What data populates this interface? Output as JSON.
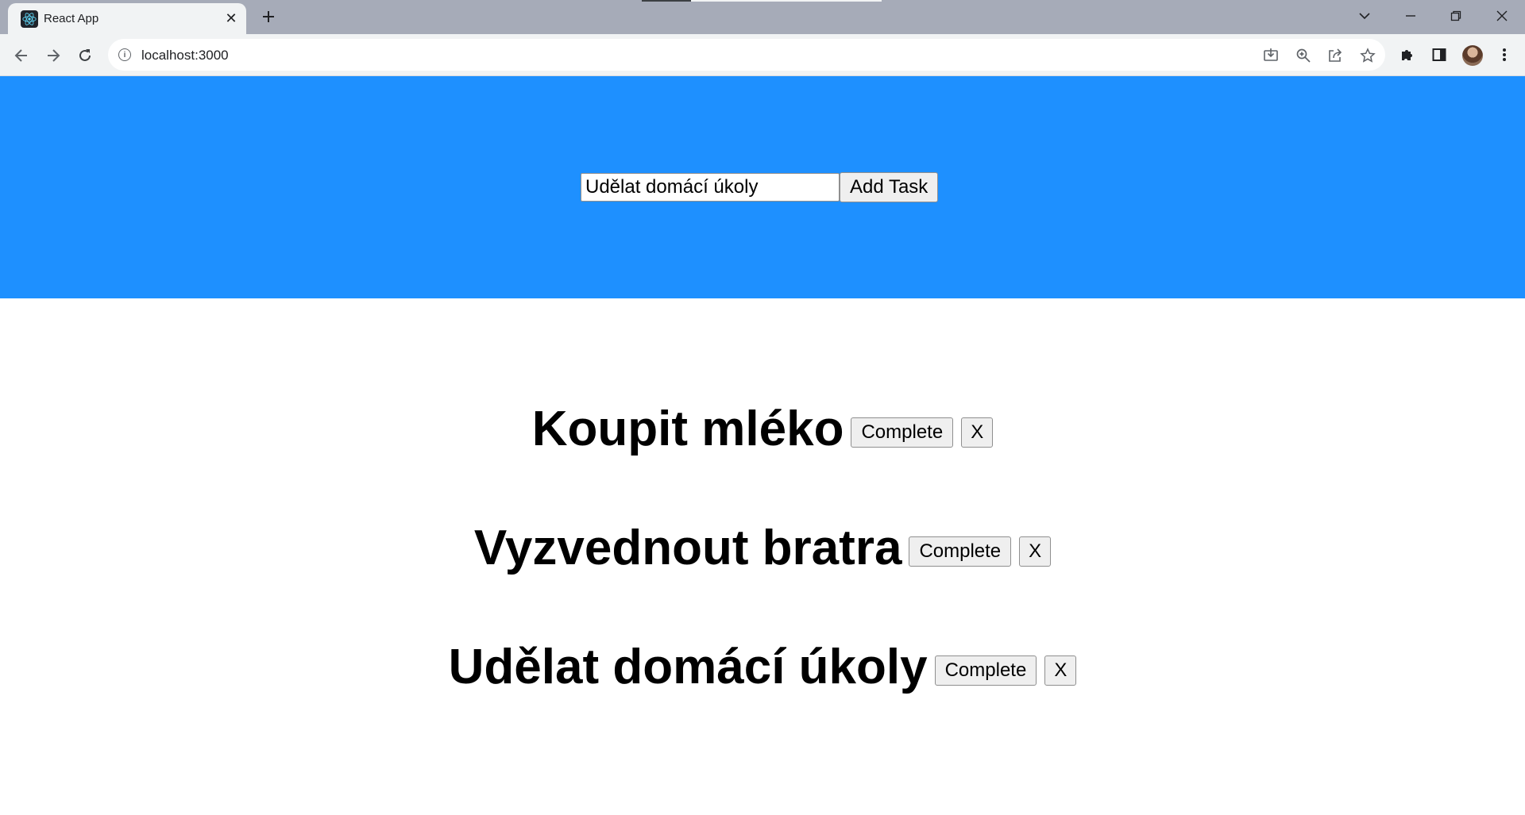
{
  "browser": {
    "tab": {
      "title": "React App"
    },
    "address": {
      "url": "localhost:3000"
    }
  },
  "colors": {
    "hero_bg": "#1e90ff",
    "tabstrip_bg": "#a6abb8",
    "toolbar_bg": "#f1f3f4"
  },
  "icons": {
    "favicon": "react-logo-icon",
    "back": "arrow-left-icon",
    "forward": "arrow-right-icon",
    "reload": "reload-icon",
    "site_info": "info-icon",
    "install": "install-icon",
    "zoom": "zoom-icon",
    "share": "share-icon",
    "bookmark": "star-icon",
    "extensions": "puzzle-icon",
    "side_panel": "side-panel-icon",
    "menu": "kebab-menu-icon"
  },
  "app": {
    "form": {
      "input_value": "Udělat domácí úkoly",
      "add_label": "Add Task"
    },
    "tasks": [
      {
        "title": "Koupit mléko",
        "complete_label": "Complete",
        "delete_label": "X"
      },
      {
        "title": "Vyzvednout bratra",
        "complete_label": "Complete",
        "delete_label": "X"
      },
      {
        "title": "Udělat domácí úkoly",
        "complete_label": "Complete",
        "delete_label": "X"
      }
    ]
  }
}
